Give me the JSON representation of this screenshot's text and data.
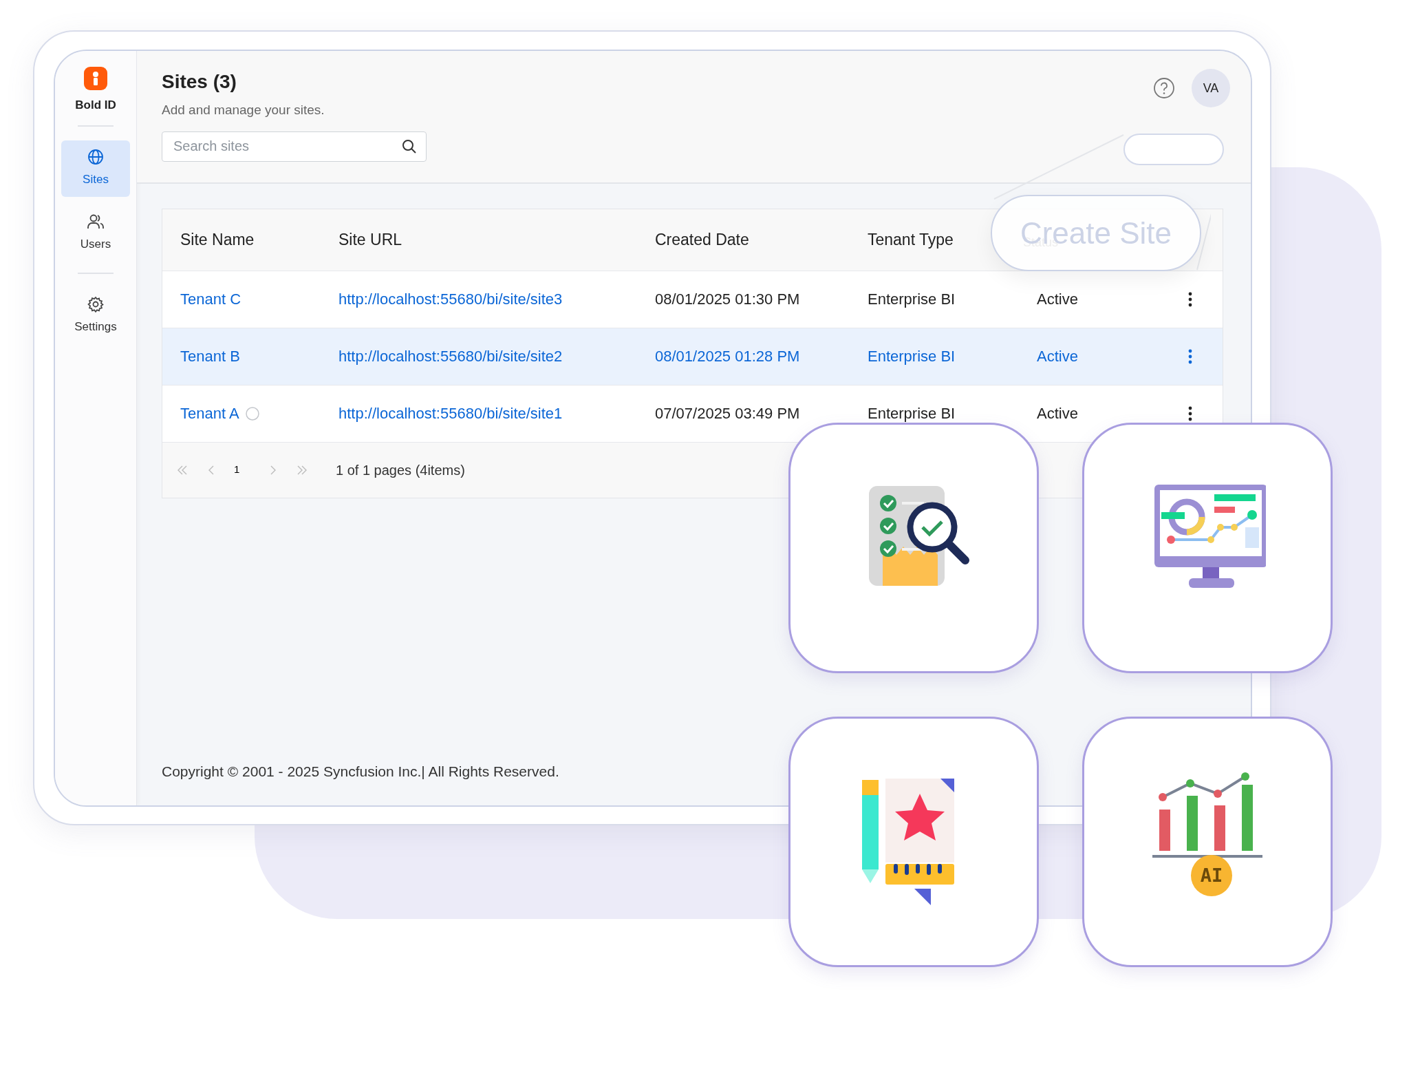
{
  "sidebar": {
    "brand": "Bold ID",
    "items": [
      {
        "label": "Sites",
        "selected": true
      },
      {
        "label": "Users",
        "selected": false
      },
      {
        "label": "Settings",
        "selected": false
      }
    ]
  },
  "header": {
    "title": "Sites (3)",
    "subtitle": "Add and manage your sites.",
    "search": {
      "placeholder": "Search sites"
    },
    "avatar": "VA",
    "create_button": "Create Site"
  },
  "table": {
    "columns": [
      "Site Name",
      "Site URL",
      "Created Date",
      "Tenant Type",
      "Status"
    ],
    "rows": [
      {
        "name": "Tenant C",
        "url": "http://localhost:55680/bi/site/site3",
        "created": "08/01/2025 01:30 PM",
        "tenant_type": "Enterprise BI",
        "status": "Active",
        "selected": false,
        "busy": false
      },
      {
        "name": "Tenant B",
        "url": "http://localhost:55680/bi/site/site2",
        "created": "08/01/2025 01:28 PM",
        "tenant_type": "Enterprise BI",
        "status": "Active",
        "selected": true,
        "busy": false
      },
      {
        "name": "Tenant A",
        "url": "http://localhost:55680/bi/site/site1",
        "created": "07/07/2025 03:49 PM",
        "tenant_type": "Enterprise BI",
        "status": "Active",
        "selected": false,
        "busy": true
      }
    ]
  },
  "pager": {
    "page": "1",
    "summary": "1 of 1 pages (4items)"
  },
  "footer": "Copyright © 2001 - 2025 Syncfusion Inc.| All Rights Reserved.",
  "illustrations": {
    "chart_badge": "AI"
  }
}
